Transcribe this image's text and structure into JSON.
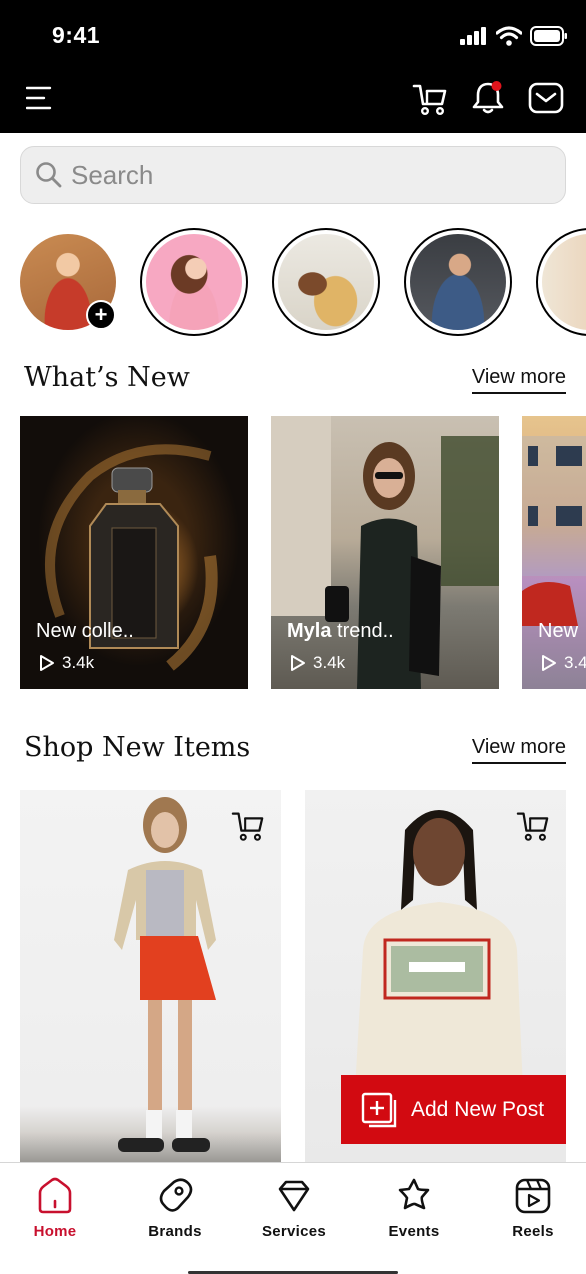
{
  "status_bar": {
    "time": "9:41"
  },
  "search": {
    "placeholder": "Search"
  },
  "stories": [
    {
      "name": "own-story"
    },
    {
      "name": "story-2"
    },
    {
      "name": "story-3"
    },
    {
      "name": "story-4"
    },
    {
      "name": "story-5"
    }
  ],
  "whats_new": {
    "title": "What’s New",
    "view_more": "View more",
    "cards": [
      {
        "caption": "New colle..",
        "views": "3.4k"
      },
      {
        "caption_bold": "Myla",
        "caption": " trend..",
        "views": "3.4k"
      },
      {
        "caption": "New",
        "views": "3.4"
      }
    ]
  },
  "shop": {
    "title": "Shop New Items",
    "view_more": "View more"
  },
  "fab": {
    "label": "Add New Post"
  },
  "nav": {
    "items": [
      {
        "label": "Home"
      },
      {
        "label": "Brands"
      },
      {
        "label": "Services"
      },
      {
        "label": "Events"
      },
      {
        "label": "Reels"
      }
    ]
  },
  "colors": {
    "accent": "#d20a11",
    "active_nav": "#c8102e",
    "header_bg": "#000000"
  }
}
